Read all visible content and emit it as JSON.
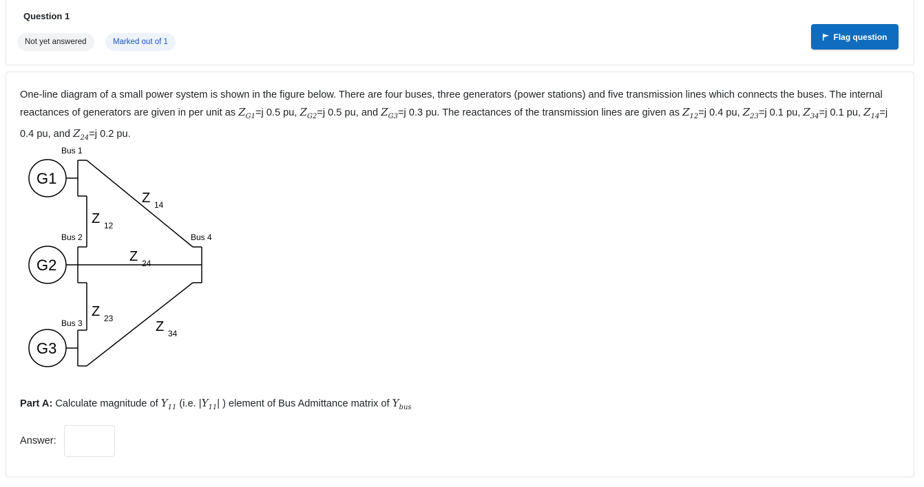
{
  "question": {
    "number_label": "Question 1",
    "state": "Not yet answered",
    "marked": "Marked out of 1",
    "flag_label": "Flag question"
  },
  "text": {
    "p1": "One-line diagram of a small power system  is shown in the figure below. There are four buses, three generators (power stations) and five transmission lines which connects the buses. The internal reactances of generators are given in per unit as ",
    "zg1_var": "Z",
    "zg1_sub": "G1",
    "zg1_val": "=j 0.5 pu, ",
    "zg2_var": "Z",
    "zg2_sub": "G2",
    "zg2_val": "=j 0.5 pu, and ",
    "zg3_var": "Z",
    "zg3_sub": "G3",
    "zg3_val": "=j 0.3 pu. The reactances of the transmission lines are given as ",
    "z12_var": "Z",
    "z12_sub": "12",
    "z12_val": "=j 0.4 pu, ",
    "z23_var": "Z",
    "z23_sub": "23",
    "z23_val": "=j 0.1 pu, ",
    "z34_var": "Z",
    "z34_sub": "34",
    "z34_val": "=j 0.1 pu, ",
    "z14_var": "Z",
    "z14_sub": "14",
    "z14_val": "=j 0.4 pu, and ",
    "z24_var": "Z",
    "z24_sub": "24",
    "z24_val": "=j 0.2 pu."
  },
  "diagram": {
    "bus1": "Bus 1",
    "bus2": "Bus 2",
    "bus3": "Bus 3",
    "bus4": "Bus 4",
    "g1": "G1",
    "g2": "G2",
    "g3": "G3",
    "z_letter": "Z",
    "z14_sub": "14",
    "z12_sub": "12",
    "z24_sub": "24",
    "z23_sub": "23",
    "z34_sub": "34"
  },
  "part_a": {
    "label": "Part A:",
    "text1": " Calculate magnitude of ",
    "y11_var": "Y",
    "y11_sub": "11",
    "text2": "  (i.e. |",
    "y11b_var": "Y",
    "y11b_sub": "11",
    "text3": "| ) element of Bus Admittance matrix of ",
    "ybus_var": "Y",
    "ybus_sub": "bus"
  },
  "answer": {
    "label": "Answer:",
    "value": ""
  }
}
